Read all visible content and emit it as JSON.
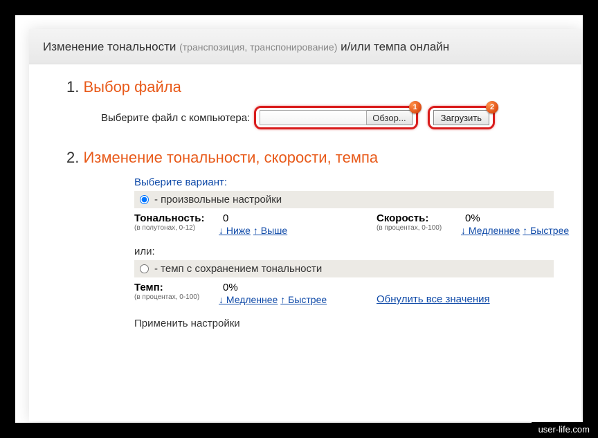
{
  "header": {
    "prefix": "Изменение тональности ",
    "paren": "(транспозиция, транспонирование)",
    "suffix": " и/или темпа онлайн"
  },
  "step1": {
    "num": "1.",
    "title": "Выбор файла",
    "label": "Выберите файл с компьютера:",
    "browse": "Обзор...",
    "upload": "Загрузить",
    "badge1": "1",
    "badge2": "2"
  },
  "step2": {
    "num": "2.",
    "title": "Изменение тональности, скорости, темпа",
    "variant_label": "Выберите вариант:",
    "option_custom": "- произвольные настройки",
    "option_tempo": "- темп с сохранением тональности",
    "or": "или:",
    "tone": {
      "label": "Тональность:",
      "value": "0",
      "sub": "(в полутонах, 0-12)",
      "down": "↓ Ниже",
      "up": "↑ Выше"
    },
    "speed": {
      "label": "Скорость:",
      "value": "0%",
      "sub": "(в процентах, 0-100)",
      "down": "↓ Медленнее",
      "up": "↑ Быстрее"
    },
    "tempo": {
      "label": "Темп:",
      "value": "0%",
      "sub": "(в процентах, 0-100)",
      "down": "↓ Медленнее",
      "up": "↑ Быстрее"
    },
    "reset": "Обнулить все значения",
    "apply": "Применить настройки"
  },
  "watermark": "user-life.com"
}
